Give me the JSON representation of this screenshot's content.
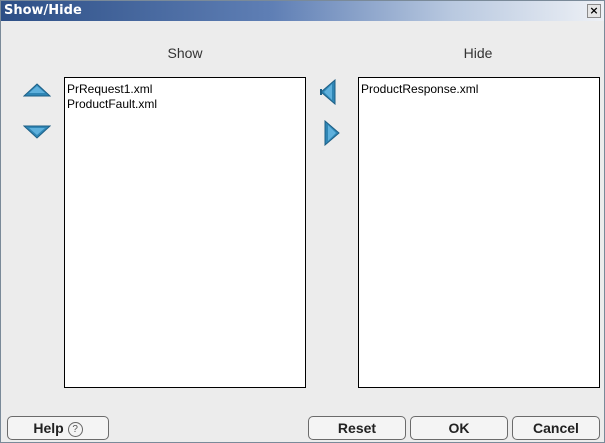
{
  "window": {
    "title": "Show/Hide",
    "close_glyph": "×"
  },
  "show_panel": {
    "header": "Show",
    "items": [
      "PrRequest1.xml",
      "ProductFault.xml"
    ],
    "move_up_icon": "triangle-up-icon",
    "move_down_icon": "triangle-down-icon"
  },
  "hide_panel": {
    "header": "Hide",
    "items": [
      "ProductResponse.xml"
    ]
  },
  "transfer": {
    "to_show_icon": "arrow-left-icon",
    "to_hide_icon": "arrow-right-icon"
  },
  "buttons": {
    "help": "Help",
    "help_glyph": "?",
    "reset": "Reset",
    "ok": "OK",
    "cancel": "Cancel"
  },
  "colors": {
    "title_bar_start": "#2d4f86",
    "arrow_blue": "#2f86b5",
    "dialog_bg": "#ececec"
  }
}
